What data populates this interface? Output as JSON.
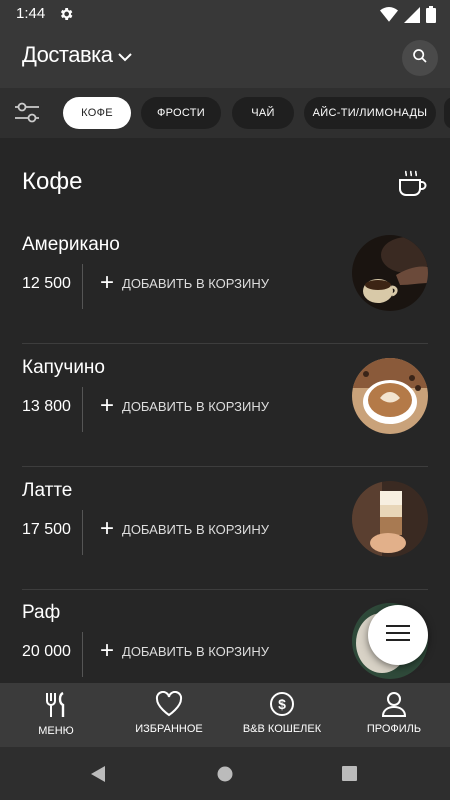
{
  "status": {
    "time": "1:44"
  },
  "header": {
    "title": "Доставка"
  },
  "filters": [
    {
      "label": "КОФЕ",
      "active": true
    },
    {
      "label": "ФРОСТИ",
      "active": false
    },
    {
      "label": "ЧАЙ",
      "active": false
    },
    {
      "label": "АЙС-ТИ/ЛИМОНАДЫ",
      "active": false
    }
  ],
  "section": {
    "title": "Кофе"
  },
  "items": [
    {
      "name": "Американо",
      "price": "12 500",
      "add_label": "ДОБАВИТЬ В КОРЗИНУ"
    },
    {
      "name": "Капучино",
      "price": "13 800",
      "add_label": "ДОБАВИТЬ В КОРЗИНУ"
    },
    {
      "name": "Латте",
      "price": "17 500",
      "add_label": "ДОБАВИТЬ В КОРЗИНУ"
    },
    {
      "name": "Раф",
      "price": "20 000",
      "add_label": "ДОБАВИТЬ В КОРЗИНУ"
    }
  ],
  "bottom_nav": [
    {
      "label": "МЕНЮ",
      "icon": "fork-knife-icon"
    },
    {
      "label": "ИЗБРАННОЕ",
      "icon": "heart-icon"
    },
    {
      "label": "B&B КОШЕЛЕК",
      "icon": "dollar-coin-icon"
    },
    {
      "label": "ПРОФИЛЬ",
      "icon": "person-icon"
    }
  ]
}
